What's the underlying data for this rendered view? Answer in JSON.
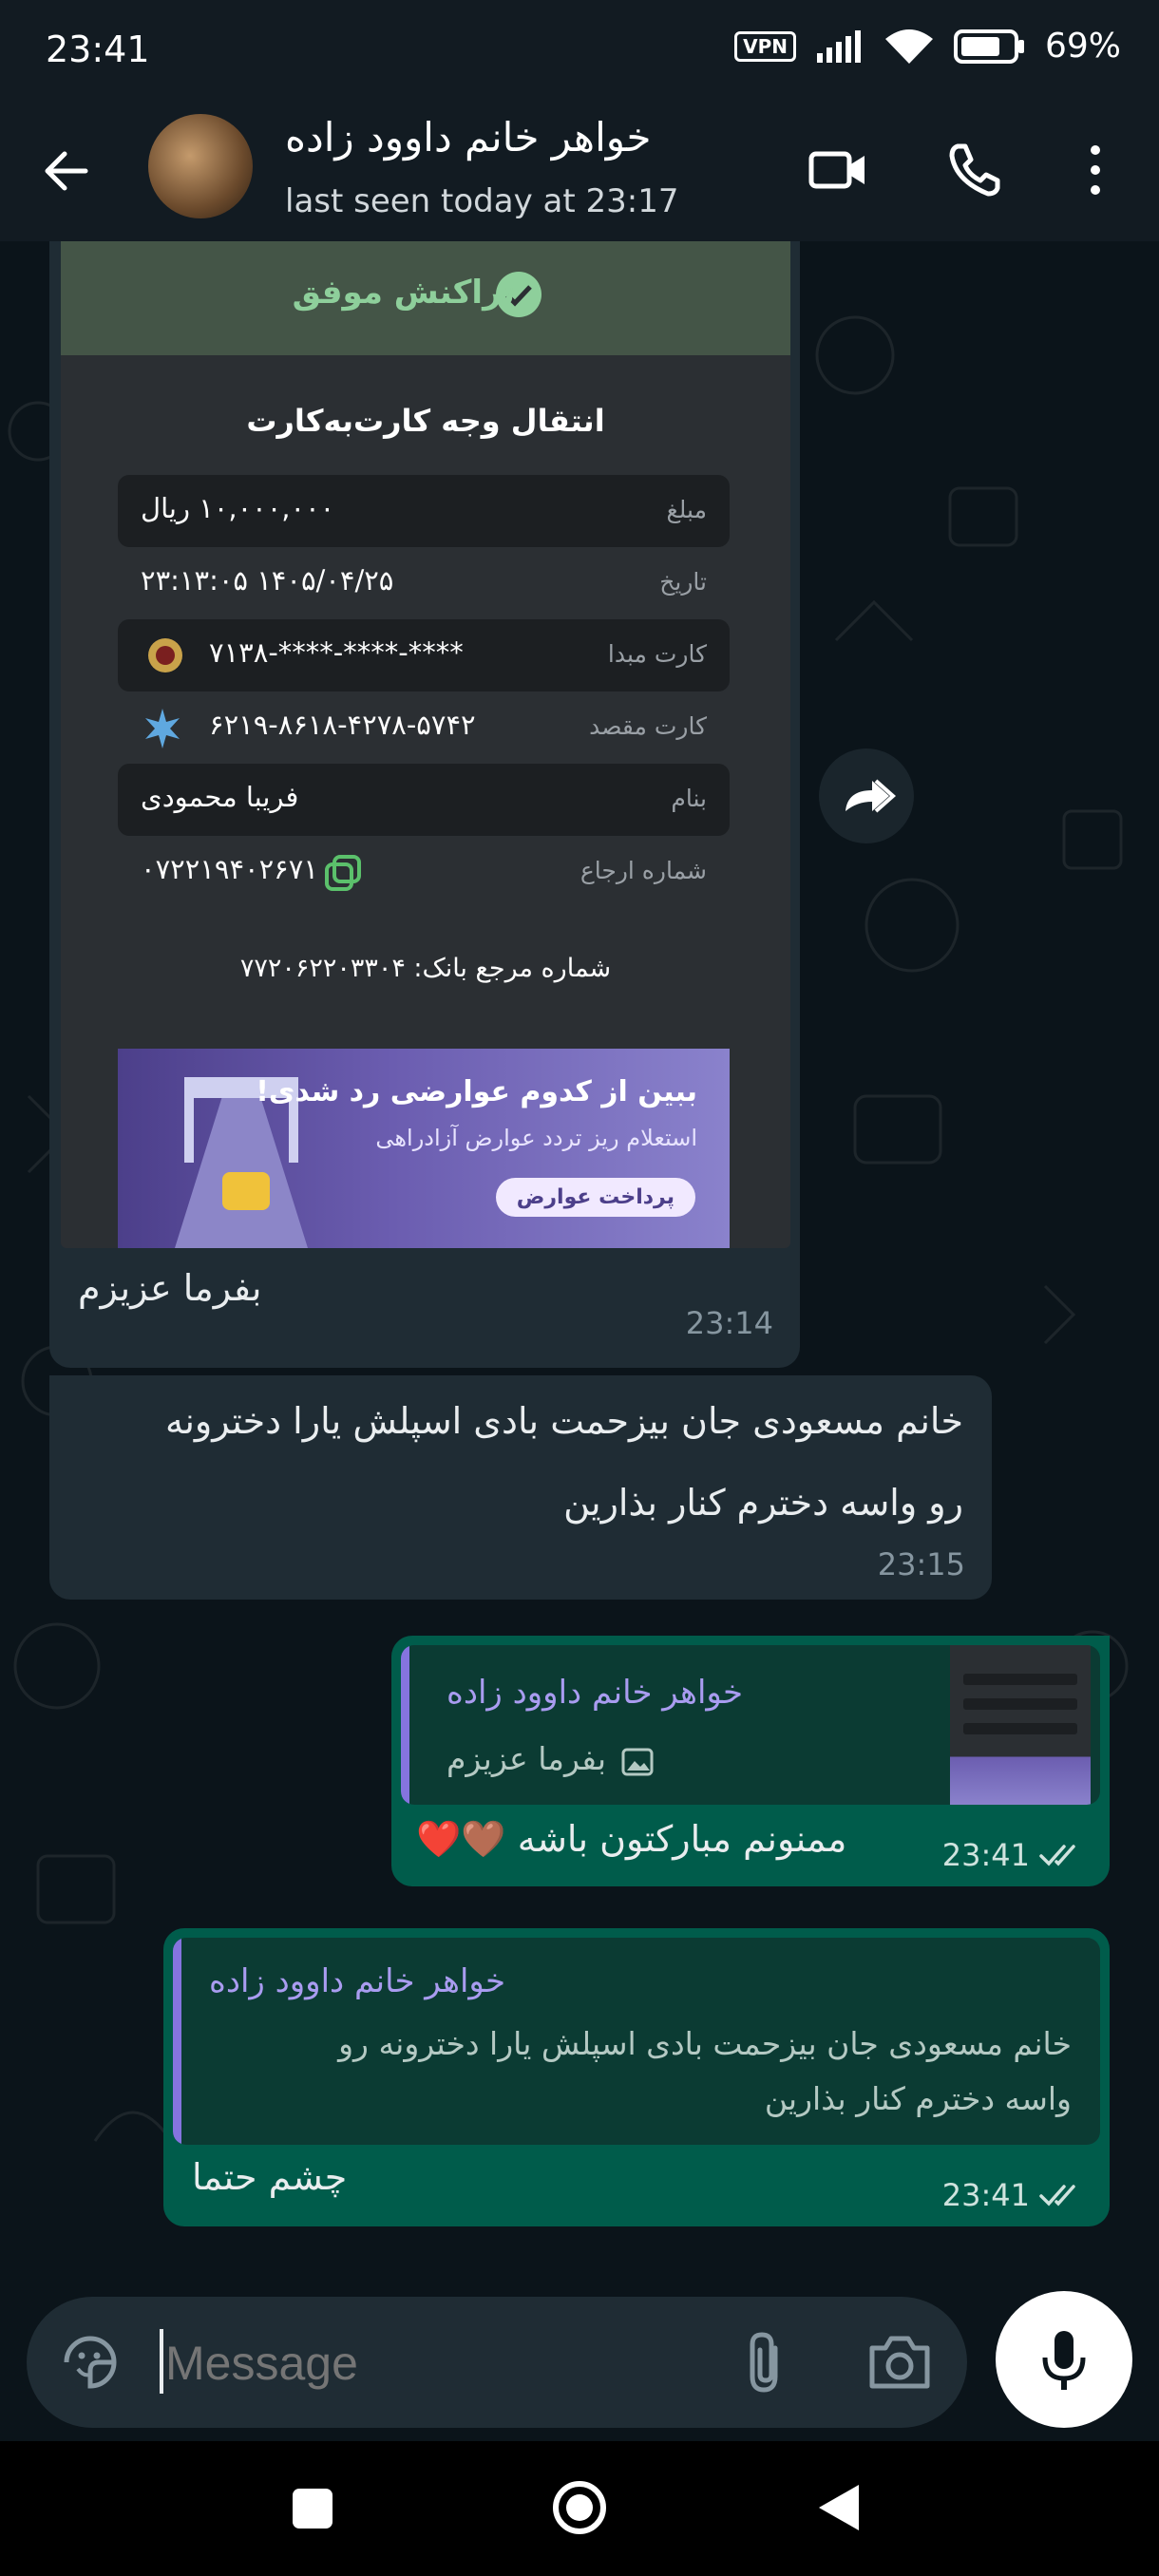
{
  "status_bar": {
    "time": "23:41",
    "vpn": "VPN",
    "battery": "69%"
  },
  "header": {
    "contact_name": "خواهر خانم داوود زاده",
    "last_seen": "last seen today at 23:17"
  },
  "receipt": {
    "status": "تراکنش موفق",
    "title": "انتقال وجه کارت‌به‌کارت",
    "amount_label": "مبلغ",
    "amount_value": "۱۰,۰۰۰,۰۰۰ ریال",
    "date_label": "تاریخ",
    "date_value": "۱۴۰۵/۰۴/۲۵ ۲۳:۱۳:۰۵",
    "source_label": "کارت مبدا",
    "source_value": "****-****-****-۷۱۳۸",
    "dest_label": "کارت مقصد",
    "dest_value": "۶۲۱۹-۸۶۱۸-۴۲۷۸-۵۷۴۲",
    "name_label": "بنام",
    "name_value": "فریبا محمودی",
    "ref_label": "شماره ارجاع",
    "ref_value": "۰۷۲۲۱۹۴۰۲۶۷۱",
    "bank_ref": "شماره مرجع بانک: ۷۷۲۰۶۲۲۰۳۳۰۴",
    "ad_title": "ببین از کدوم عوارضی رد شدی!",
    "ad_subtitle": "استعلام ریز تردد عوارض آزادراهی",
    "ad_button": "پرداخت عوارض"
  },
  "messages": [
    {
      "id": "m1",
      "direction": "in",
      "text": "بفرما عزیزم",
      "time": "23:14"
    },
    {
      "id": "m2",
      "direction": "in",
      "text_line1": "خانم مسعودی جان بیزحمت بادی اسپلش یارا دخترونه",
      "text_line2": "رو واسه دخترم کنار بذارین",
      "time": "23:15"
    },
    {
      "id": "m3",
      "direction": "out",
      "quote_name": "خواهر خانم داوود زاده",
      "quote_text": "بفرما عزیزم",
      "text": "ممنونم مبارکتون باشه 🤎❤️",
      "time": "23:41"
    },
    {
      "id": "m4",
      "direction": "out",
      "quote_name": "خواهر خانم داوود زاده",
      "quote_line1": "خانم مسعودی جان بیزحمت بادی اسپلش یارا دخترونه رو",
      "quote_line2": "واسه دخترم کنار بذارین",
      "text": "چشم حتما",
      "time": "23:41"
    }
  ],
  "composer": {
    "placeholder": "Message"
  },
  "colors": {
    "incoming": "#1f2c34",
    "outgoing": "#005c4b",
    "quote_accent": "#8574df",
    "background": "#0b141a"
  },
  "icons": [
    "back-arrow-icon",
    "video-call-icon",
    "voice-call-icon",
    "more-options-icon",
    "forward-icon",
    "emoji-icon",
    "attach-icon",
    "camera-icon",
    "mic-icon",
    "read-ticks-icon"
  ]
}
